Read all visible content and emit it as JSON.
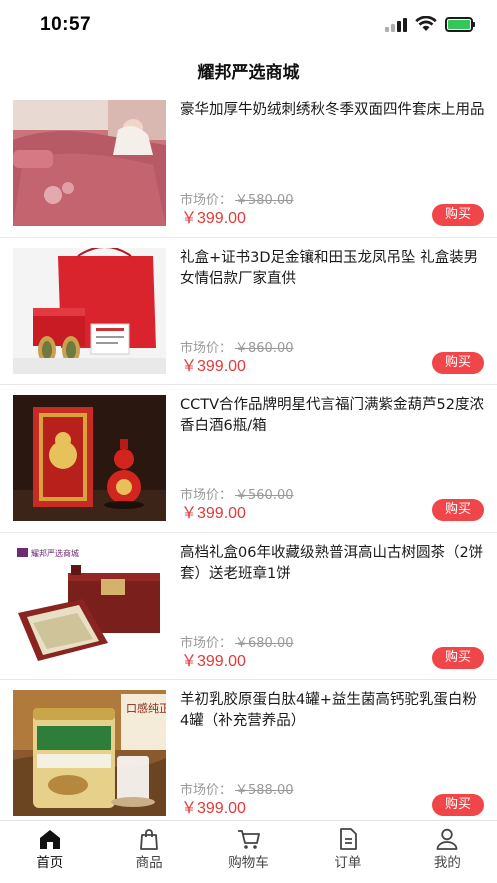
{
  "status_bar": {
    "time": "10:57",
    "icons": [
      "signal-icon",
      "wifi-icon",
      "battery-charging-icon"
    ],
    "battery_color": "#34c759"
  },
  "header": {
    "title": "耀邦严选商城"
  },
  "products": [
    {
      "title": "豪华加厚牛奶绒刺绣秋冬季双面四件套床上用品",
      "market_label": "市场价：",
      "market_price": "￥580.00",
      "sale_price": "￥399.00",
      "buy_label": "购买",
      "image": "bedding-set-image"
    },
    {
      "title": "礼盒+证书3D足金镶和田玉龙凤吊坠 礼盒装男女情侣款厂家直供",
      "market_label": "市场价：",
      "market_price": "￥860.00",
      "sale_price": "￥399.00",
      "buy_label": "购买",
      "image": "jade-pendant-giftbox-image"
    },
    {
      "title": "CCTV合作品牌明星代言福门满紫金葫芦52度浓香白酒6瓶/箱",
      "market_label": "市场价：",
      "market_price": "￥560.00",
      "sale_price": "￥399.00",
      "buy_label": "购买",
      "image": "gourd-liquor-image"
    },
    {
      "title": "高档礼盒06年收藏级熟普洱高山古树圆茶（2饼套）送老班章1饼",
      "market_label": "市场价：",
      "market_price": "￥680.00",
      "sale_price": "￥399.00",
      "buy_label": "购买",
      "image": "puer-tea-giftbox-image",
      "image_text": "耀邦严选商城"
    },
    {
      "title": "羊初乳胶原蛋白肽4罐+益生菌高钙驼乳蛋白粉4罐（补充营养品）",
      "market_label": "市场价：",
      "market_price": "￥588.00",
      "sale_price": "￥399.00",
      "buy_label": "购买",
      "image": "camel-milk-powder-image",
      "image_text": "口感纯正"
    }
  ],
  "tab_bar": {
    "active_index": 0,
    "items": [
      {
        "label": "首页",
        "icon": "home-icon"
      },
      {
        "label": "商品",
        "icon": "shopping-bag-icon"
      },
      {
        "label": "购物车",
        "icon": "cart-icon"
      },
      {
        "label": "订单",
        "icon": "order-document-icon"
      },
      {
        "label": "我的",
        "icon": "user-icon"
      }
    ]
  },
  "colors": {
    "price_red": "#e23a3a",
    "buy_button": "#f0464a",
    "market_gray": "#9a9a9a"
  }
}
